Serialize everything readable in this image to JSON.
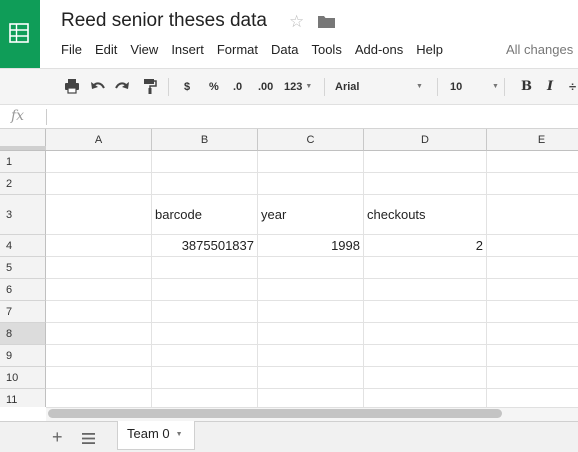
{
  "doc": {
    "title": "Reed senior theses data",
    "save_status": "All changes"
  },
  "menu": [
    "File",
    "Edit",
    "View",
    "Insert",
    "Format",
    "Data",
    "Tools",
    "Add-ons",
    "Help"
  ],
  "toolbar": {
    "currency_label": "$",
    "percent_label": "%",
    "decrease_decimal_label": ".0",
    "increase_decimal_label": ".00",
    "more_formats_label": "123",
    "font_family": "Arial",
    "font_size": "10",
    "bold_label": "B",
    "italic_label": "I"
  },
  "formula_bar": {
    "fx_label": "fx",
    "value": ""
  },
  "grid": {
    "columns": [
      "A",
      "B",
      "C",
      "D",
      "E"
    ],
    "rows": [
      "1",
      "2",
      "3",
      "4",
      "5",
      "6",
      "7",
      "8",
      "9",
      "10",
      "11"
    ],
    "selected_row": "8",
    "cells": {
      "B3": "barcode",
      "C3": "year",
      "D3": "checkouts",
      "B4": "3875501837",
      "C4": "1998",
      "D4": "2"
    }
  },
  "sheets": {
    "active_tab": "Team 0"
  },
  "colors": {
    "brand": "#0f9d58"
  }
}
